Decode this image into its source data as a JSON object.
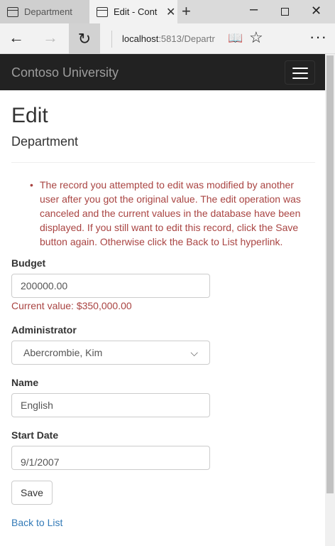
{
  "browser": {
    "tabs": [
      {
        "title": "Departments -",
        "active": false
      },
      {
        "title": "Edit - Cont",
        "active": true
      }
    ],
    "address_host": "localhost",
    "address_rest": ":5813/Departr",
    "icons": {
      "back": "back-arrow-icon",
      "forward": "forward-arrow-icon",
      "refresh": "refresh-icon",
      "reading": "reading-view-icon",
      "favorite": "star-icon",
      "more": "more-icon"
    }
  },
  "site": {
    "brand": "Contoso University"
  },
  "page": {
    "heading": "Edit",
    "subheading": "Department",
    "validation_message": "The record you attempted to edit was modified by another user after you got the original value. The edit operation was canceled and the current values in the database have been displayed. If you still want to edit this record, click the Save button again. Otherwise click the Back to List hyperlink.",
    "budget": {
      "label": "Budget",
      "value": "200000.00",
      "current_value": "Current value: $350,000.00"
    },
    "administrator": {
      "label": "Administrator",
      "selected": "Abercrombie, Kim"
    },
    "name": {
      "label": "Name",
      "value": "English"
    },
    "start_date": {
      "label": "Start Date",
      "value": "9/1/2007"
    },
    "save_label": "Save",
    "back_link": "Back to List"
  },
  "colors": {
    "navbar": "#222222",
    "brand_text": "#9d9d9d",
    "error": "#a94442",
    "link": "#337ab7"
  }
}
